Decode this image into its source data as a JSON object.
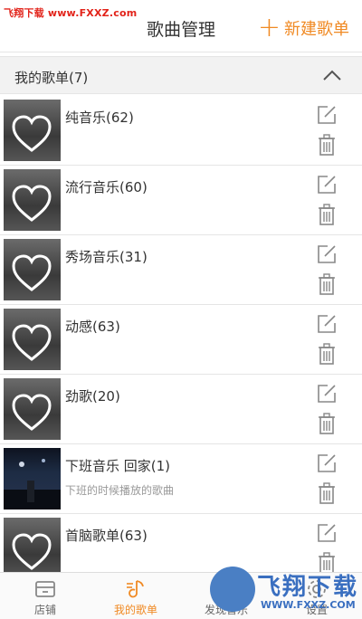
{
  "watermark": {
    "site": "飞翔下载 www.FXXZ.com"
  },
  "header": {
    "title": "歌曲管理",
    "new_playlist_label": "新建歌单"
  },
  "section": {
    "label": "我的歌单(7)"
  },
  "playlists": [
    {
      "name": "纯音乐(62)",
      "desc": ""
    },
    {
      "name": "流行音乐(60)",
      "desc": ""
    },
    {
      "name": "秀场音乐(31)",
      "desc": ""
    },
    {
      "name": "动感(63)",
      "desc": ""
    },
    {
      "name": "劲歌(20)",
      "desc": ""
    },
    {
      "name": "下班音乐 回家(1)",
      "desc": "下班的时候播放的歌曲"
    },
    {
      "name": "首脑歌单(63)",
      "desc": ""
    }
  ],
  "tabs": [
    {
      "label": "店铺",
      "icon": "shop-icon"
    },
    {
      "label": "我的歌单",
      "icon": "music-note-icon"
    },
    {
      "label": "发现音乐",
      "icon": "discover-icon"
    },
    {
      "label": "设置",
      "icon": "settings-icon"
    }
  ],
  "logo_watermark": {
    "text": "飞翔下载",
    "url": "WWW.FXXZ.COM"
  },
  "colors": {
    "accent": "#f08a24",
    "divider": "#e5e5e5",
    "section_bg": "#f2f2f2"
  }
}
